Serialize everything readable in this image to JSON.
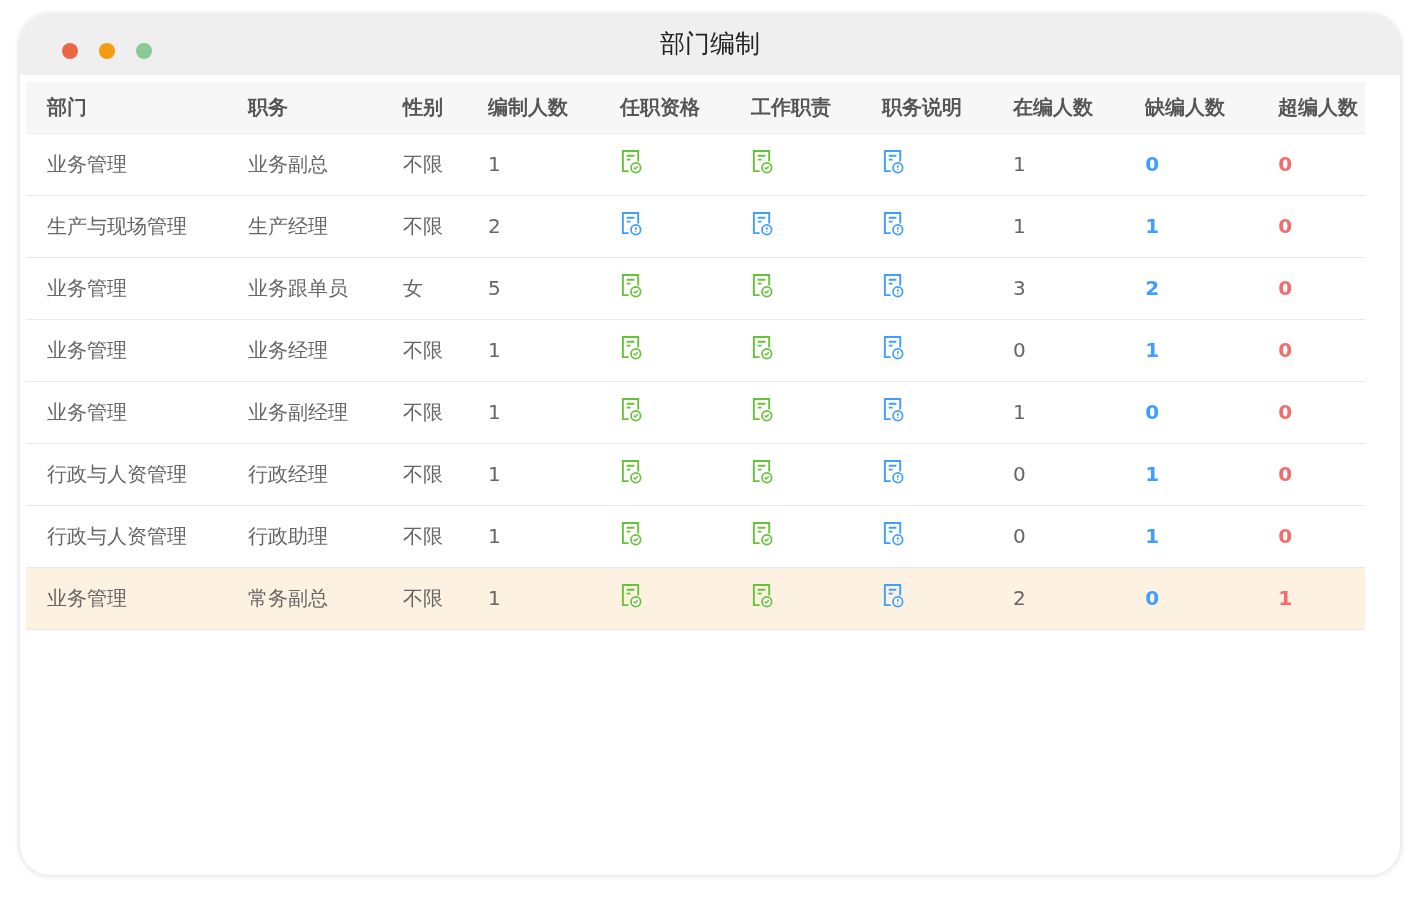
{
  "window": {
    "title": "部门编制"
  },
  "table": {
    "columns": [
      "部门",
      "职务",
      "性别",
      "编制人数",
      "任职资格",
      "工作职责",
      "职务说明",
      "在编人数",
      "缺编人数",
      "超编人数"
    ],
    "rows": [
      {
        "selected": false,
        "department": "业务管理",
        "position": "业务副总",
        "gender": "不限",
        "quota": "1",
        "icons": [
          {
            "kind": "check"
          },
          {
            "kind": "check"
          },
          {
            "kind": "alert"
          }
        ],
        "staffed": "1",
        "shortage": "0",
        "excess": "0"
      },
      {
        "selected": false,
        "department": "生产与现场管理",
        "position": "生产经理",
        "gender": "不限",
        "quota": "2",
        "icons": [
          {
            "kind": "alert"
          },
          {
            "kind": "alert"
          },
          {
            "kind": "alert"
          }
        ],
        "staffed": "1",
        "shortage": "1",
        "excess": "0"
      },
      {
        "selected": false,
        "department": "业务管理",
        "position": "业务跟单员",
        "gender": "女",
        "quota": "5",
        "icons": [
          {
            "kind": "check"
          },
          {
            "kind": "check"
          },
          {
            "kind": "alert"
          }
        ],
        "staffed": "3",
        "shortage": "2",
        "excess": "0"
      },
      {
        "selected": false,
        "department": "业务管理",
        "position": "业务经理",
        "gender": "不限",
        "quota": "1",
        "icons": [
          {
            "kind": "check"
          },
          {
            "kind": "check"
          },
          {
            "kind": "alert"
          }
        ],
        "staffed": "0",
        "shortage": "1",
        "excess": "0"
      },
      {
        "selected": false,
        "department": "业务管理",
        "position": "业务副经理",
        "gender": "不限",
        "quota": "1",
        "icons": [
          {
            "kind": "check"
          },
          {
            "kind": "check"
          },
          {
            "kind": "alert"
          }
        ],
        "staffed": "1",
        "shortage": "0",
        "excess": "0"
      },
      {
        "selected": false,
        "department": "行政与人资管理",
        "position": "行政经理",
        "gender": "不限",
        "quota": "1",
        "icons": [
          {
            "kind": "check"
          },
          {
            "kind": "check"
          },
          {
            "kind": "alert"
          }
        ],
        "staffed": "0",
        "shortage": "1",
        "excess": "0"
      },
      {
        "selected": false,
        "department": "行政与人资管理",
        "position": "行政助理",
        "gender": "不限",
        "quota": "1",
        "icons": [
          {
            "kind": "check"
          },
          {
            "kind": "check"
          },
          {
            "kind": "alert"
          }
        ],
        "staffed": "0",
        "shortage": "1",
        "excess": "0"
      },
      {
        "selected": true,
        "department": "业务管理",
        "position": "常务副总",
        "gender": "不限",
        "quota": "1",
        "icons": [
          {
            "kind": "check"
          },
          {
            "kind": "check"
          },
          {
            "kind": "alert"
          }
        ],
        "staffed": "2",
        "shortage": "0",
        "excess": "1"
      }
    ]
  }
}
